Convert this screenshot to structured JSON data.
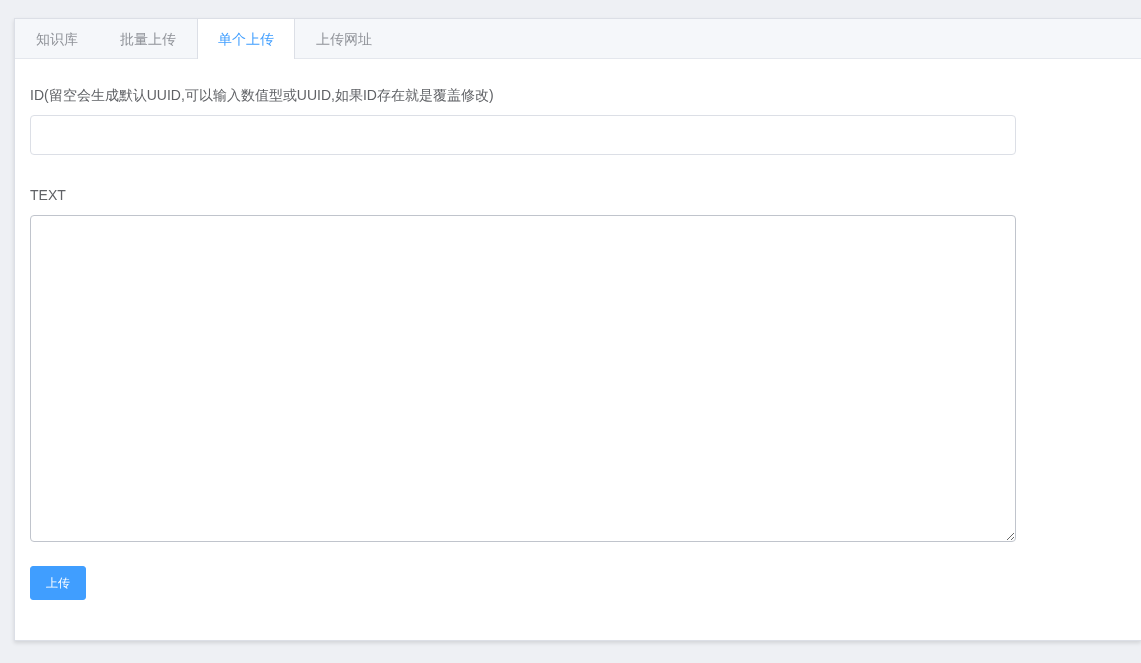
{
  "tabs": [
    {
      "label": "知识库",
      "selected": false
    },
    {
      "label": "批量上传",
      "selected": false
    },
    {
      "label": "单个上传",
      "selected": true
    },
    {
      "label": "上传网址",
      "selected": false
    }
  ],
  "form": {
    "id_label": "ID(留空会生成默认UUID,可以输入数值型或UUID,如果ID存在就是覆盖修改)",
    "text_label": "TEXT",
    "submit": "上传"
  }
}
